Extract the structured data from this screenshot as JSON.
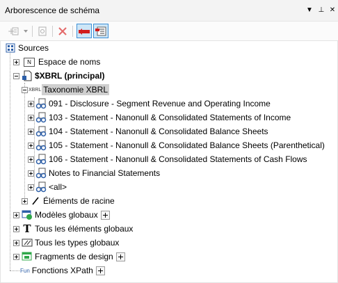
{
  "panel": {
    "title": "Arborescence de schéma"
  },
  "window_buttons": {
    "dropdown": "▼",
    "pin": "⊥",
    "close": "✕"
  },
  "tree": {
    "root": "Sources",
    "namespace": "Espace de noms",
    "xbrl": "$XBRL (principal)",
    "taxonomy_badge": "XBRL",
    "taxonomy": "Taxonomie XBRL",
    "statements": [
      "091 - Disclosure - Segment Revenue and Operating Income",
      "103 - Statement - Nanonull & Consolidated Statements of Income",
      "104 - Statement - Nanonull & Consolidated Balance Sheets",
      "105 - Statement - Nanonull & Consolidated Balance Sheets (Parenthetical)",
      "106 - Statement - Nanonull & Consolidated Statements of Cash Flows",
      "Notes to Financial Statements",
      "<all>"
    ],
    "root_elements": "Éléments de racine",
    "global_templates": "Modèles globaux",
    "all_global_elements": "Tous les éléments globaux",
    "all_global_types": "Tous les types globaux",
    "design_fragments": "Fragments de design",
    "xpath_functions": "Fonctions XPath",
    "fun_badge": "Fun",
    "t_glyph": "T",
    "n_glyph": "N"
  },
  "colors": {
    "selection": "#cfcfcf",
    "active_tool": "#cde6f7",
    "active_border": "#3d8fd6"
  }
}
